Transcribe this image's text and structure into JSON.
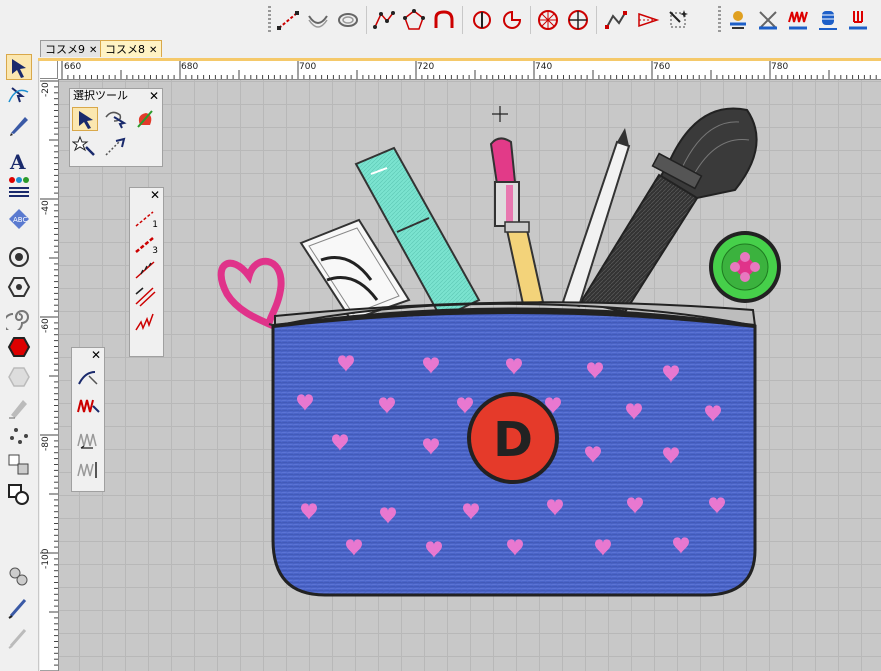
{
  "tabs": [
    {
      "label": "コスメ9",
      "close": "✕",
      "active": false
    },
    {
      "label": "コスメ8",
      "close": "✕",
      "active": true
    }
  ],
  "ruler": {
    "h_labels": [
      "660",
      "680",
      "700",
      "720",
      "740",
      "760",
      "780"
    ],
    "v_labels": [
      "-20",
      "-40",
      "-60",
      "-80",
      "-100"
    ]
  },
  "select_palette": {
    "title": "選択ツール",
    "close": "✕"
  },
  "line_palette": {
    "close": "✕"
  },
  "fill_palette": {
    "close": "✕"
  },
  "line_palette_labels": {
    "one": "1",
    "three": "3"
  },
  "artwork": {
    "badge_letter": "D"
  },
  "colors": {
    "pouch": "#4a64c8",
    "heart": "#e878d0",
    "badge": "#e53a2a",
    "accent": "#f5c96a"
  }
}
